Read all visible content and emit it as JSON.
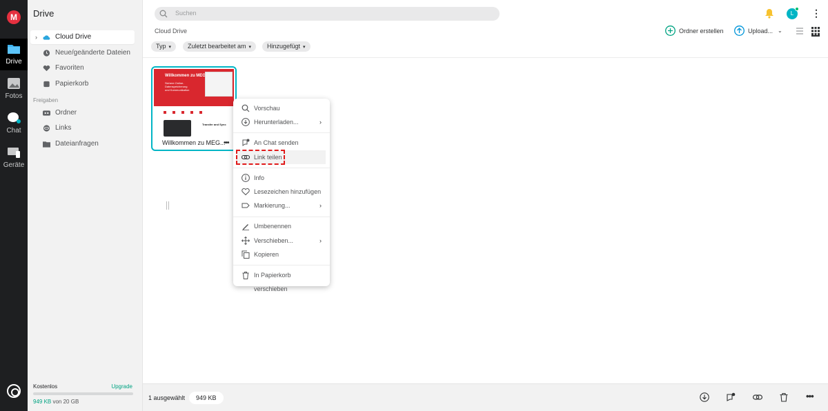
{
  "brand": {
    "logo_letter": "M",
    "accent": "#e5303f",
    "teal": "#00b5c5",
    "green": "#00a382"
  },
  "rail": {
    "items": [
      {
        "label": "Drive",
        "icon": "folder-icon"
      },
      {
        "label": "Fotos",
        "icon": "photo-icon"
      },
      {
        "label": "Chat",
        "icon": "chat-icon"
      },
      {
        "label": "Geräte",
        "icon": "devices-icon"
      }
    ]
  },
  "sidebar": {
    "title": "Drive",
    "items": [
      {
        "label": "Cloud Drive",
        "icon": "cloud-icon"
      },
      {
        "label": "Neue/geänderte Dateien",
        "icon": "clock-icon"
      },
      {
        "label": "Favoriten",
        "icon": "heart-icon"
      },
      {
        "label": "Papierkorb",
        "icon": "trash-icon"
      }
    ],
    "section_label": "Freigaben",
    "shared_items": [
      {
        "label": "Ordner",
        "icon": "shared-folder-icon"
      },
      {
        "label": "Links",
        "icon": "link-icon"
      },
      {
        "label": "Dateianfragen",
        "icon": "file-request-icon"
      }
    ],
    "storage": {
      "plan": "Kostenlos",
      "upgrade": "Upgrade",
      "used": "949 KB",
      "of_text": "von 20 GB",
      "used_fraction": 0.0
    }
  },
  "topbar": {
    "search_placeholder": "Suchen",
    "avatar_letter": "L"
  },
  "toolbar": {
    "breadcrumb": "Cloud Drive",
    "create_folder": "Ordner erstellen",
    "upload": "Upload...",
    "filters": [
      "Typ",
      "Zuletzt bearbeitet am",
      "Hinzugefügt"
    ]
  },
  "file": {
    "name": "Willkommen zu MEG...",
    "thumb_title": "Willkommen zu MEGA",
    "thumb_subtitle": "Sichere Online-Datenspeicherung und Kommunikation",
    "thumb_section": "Transfer and Sync"
  },
  "context_menu": {
    "groups": [
      [
        {
          "label": "Vorschau",
          "icon": "search-icon",
          "submenu": false
        },
        {
          "label": "Herunterladen...",
          "icon": "download-icon",
          "submenu": true
        }
      ],
      [
        {
          "label": "An Chat senden",
          "icon": "chat-send-icon",
          "submenu": false
        },
        {
          "label": "Link teilen",
          "icon": "link-icon",
          "submenu": false,
          "highlighted": true
        }
      ],
      [
        {
          "label": "Info",
          "icon": "info-icon",
          "submenu": false
        },
        {
          "label": "Lesezeichen hinzufügen",
          "icon": "heart-icon",
          "submenu": false
        },
        {
          "label": "Markierung...",
          "icon": "label-icon",
          "submenu": true
        }
      ],
      [
        {
          "label": "Umbenennen",
          "icon": "pencil-icon",
          "submenu": false
        },
        {
          "label": "Verschieben...",
          "icon": "move-icon",
          "submenu": true
        },
        {
          "label": "Kopieren",
          "icon": "copy-icon",
          "submenu": false
        }
      ],
      [
        {
          "label": "In Papierkorb verschieben",
          "icon": "trash-icon",
          "submenu": false
        }
      ]
    ]
  },
  "bottombar": {
    "selection": "1 ausgewählt",
    "size": "949 KB",
    "actions": [
      "download-icon",
      "chat-send-icon",
      "link-icon",
      "trash-icon",
      "more-icon"
    ]
  }
}
